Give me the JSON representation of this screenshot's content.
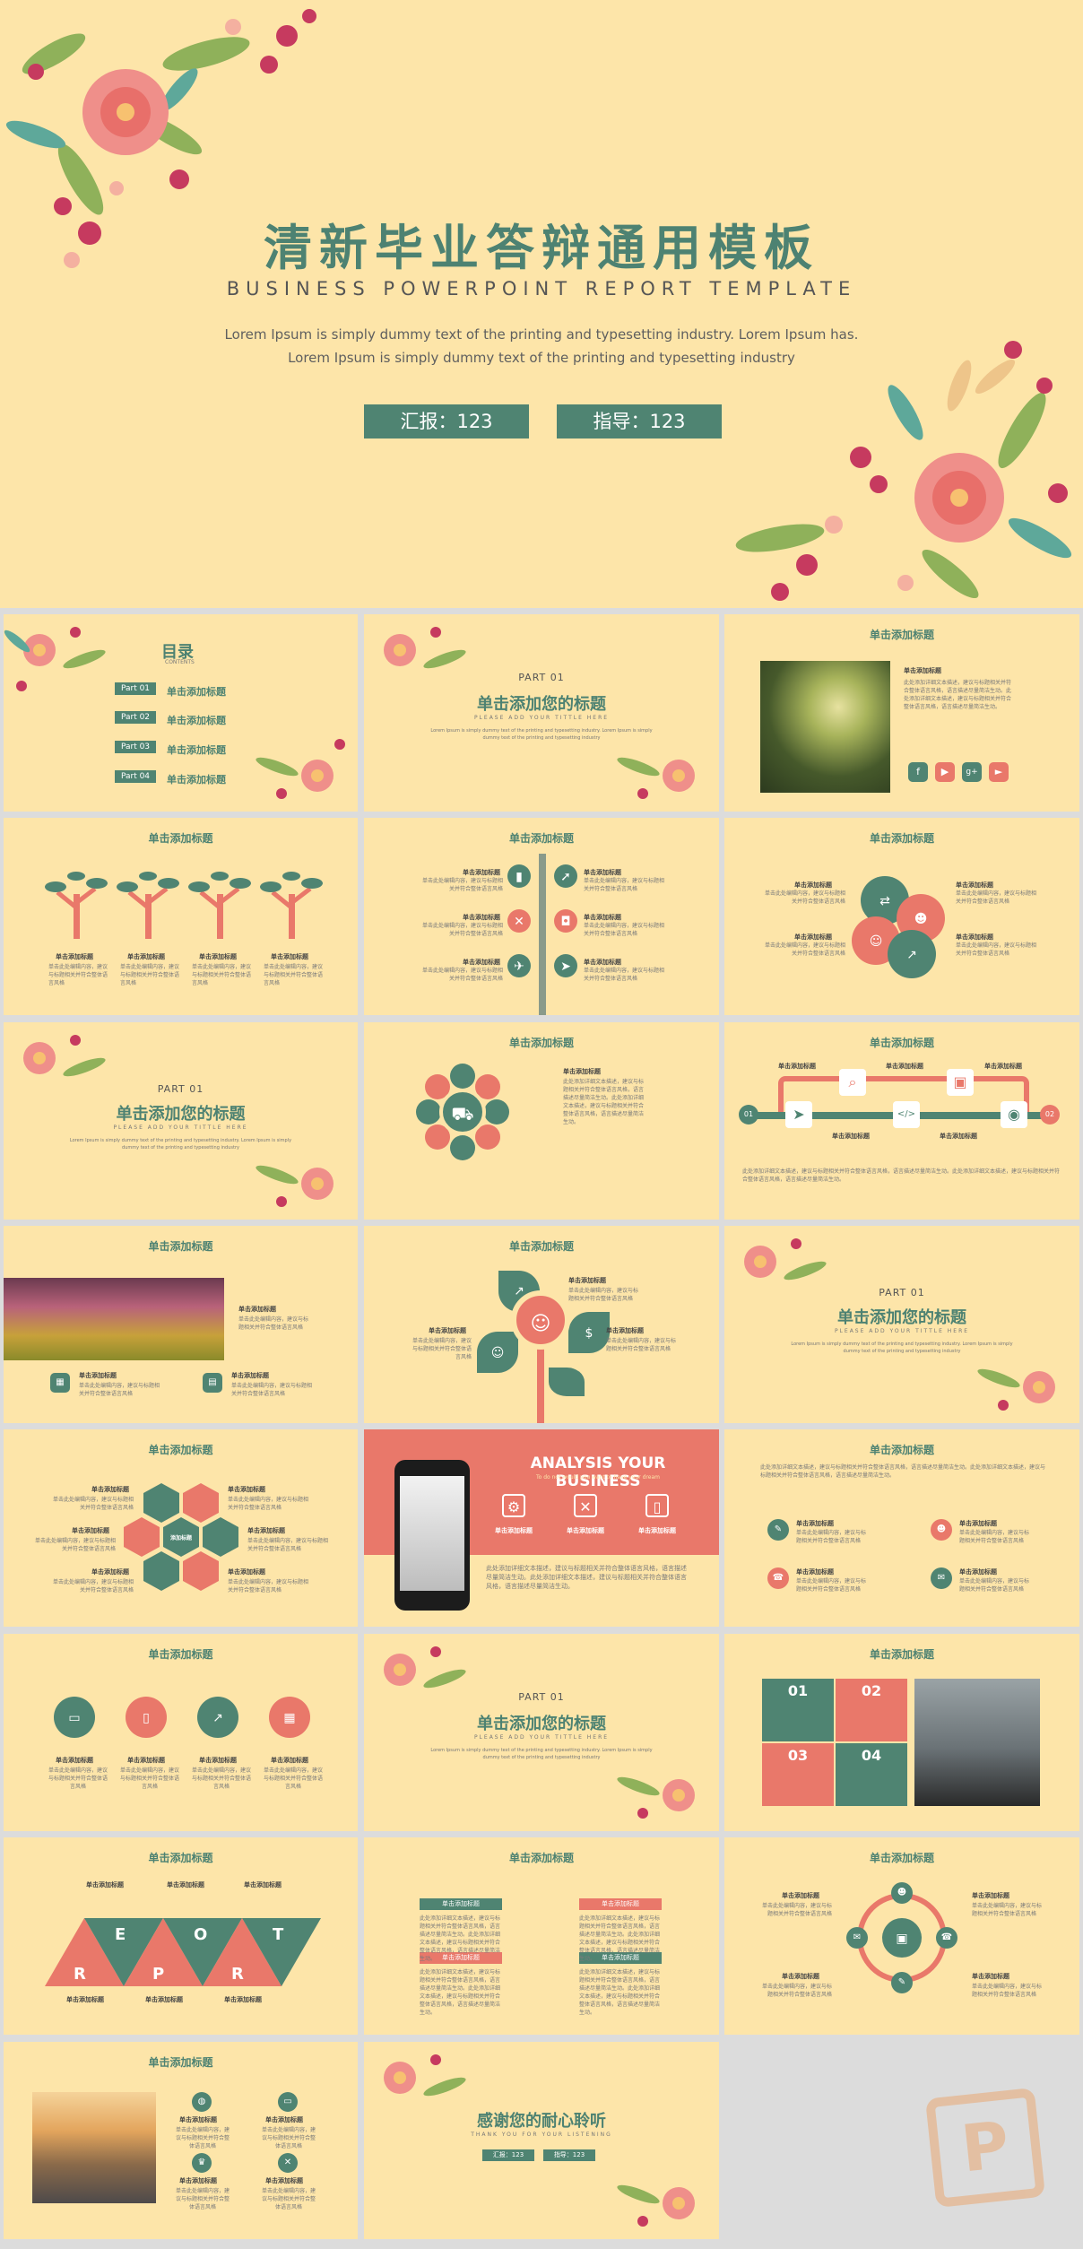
{
  "hero": {
    "title": "清新毕业答辩通用模板",
    "subtitle": "BUSINESS POWERPOINT REPORT TEMPLATE",
    "desc": "Lorem Ipsum is simply dummy text of the printing and typesetting industry. Lorem Ipsum has. Lorem Ipsum is simply dummy text of the printing and typesetting industry",
    "presenter": "汇报：123",
    "advisor": "指导：123"
  },
  "toc": {
    "title": "目录",
    "contents": "CONTENTS",
    "items": [
      {
        "tag": "Part 01",
        "label": "单击添加标题"
      },
      {
        "tag": "Part 02",
        "label": "单击添加标题"
      },
      {
        "tag": "Part 03",
        "label": "单击添加标题"
      },
      {
        "tag": "Part 04",
        "label": "单击添加标题"
      }
    ]
  },
  "section": {
    "part": "PART 01",
    "title": "单击添加您的标题",
    "sub": "PLEASE ADD YOUR TITTLE HERE",
    "desc": "Lorem Ipsum is simply dummy text of the printing and typesetting industry. Lorem Ipsum is simply dummy text of the printing and typesetting industry"
  },
  "common": {
    "slide_title": "单击添加标题",
    "item_title": "单击添加标题",
    "item_text": "单击此处编辑内容，建议与标题相关并符合整体语言风格",
    "long_text": "此处添加详细文本描述，建议与标题相关并符合整体语言风格，语言描述尽量简洁生动。此处添加详细文本描述，建议与标题相关并符合整体语言风格，语言描述尽量简洁生动。",
    "center_label": "添加标题"
  },
  "analysis": {
    "title": "ANALYSIS YOUR BUSINESS",
    "sub": "To do not would you want to have your dream"
  },
  "numbers": [
    "01",
    "02",
    "03",
    "04"
  ],
  "report_letters": [
    "R",
    "E",
    "P",
    "O",
    "R",
    "T"
  ],
  "thanks": {
    "title": "感谢您的耐心聆听",
    "sub": "THANK YOU FOR YOUR LISTENING",
    "presenter": "汇报：123",
    "advisor": "指导：123"
  },
  "social_icons": [
    "facebook-icon",
    "youtube-icon",
    "google-plus-icon",
    "play-icon"
  ],
  "colors": {
    "background": "#fde5a9",
    "green": "#4f8472",
    "coral": "#e9786a",
    "gap": "#dcdcdc"
  }
}
